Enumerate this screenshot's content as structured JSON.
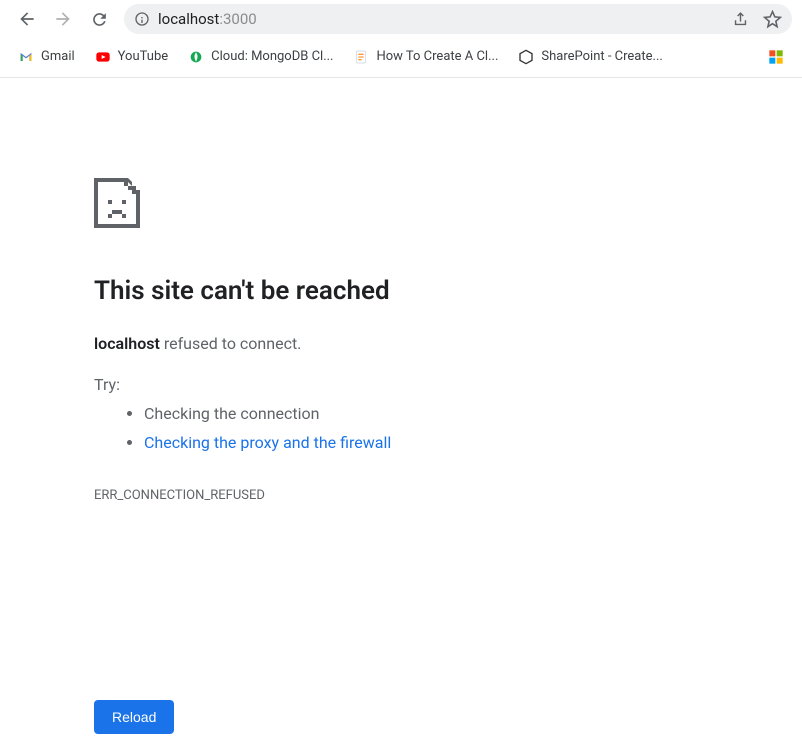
{
  "url": {
    "host": "localhost",
    "port": ":3000"
  },
  "bookmarks": [
    {
      "label": "Gmail",
      "icon": "gmail-icon"
    },
    {
      "label": "YouTube",
      "icon": "youtube-icon"
    },
    {
      "label": "Cloud: MongoDB Cl...",
      "icon": "mongodb-icon"
    },
    {
      "label": "How To Create A Cl...",
      "icon": "page-icon"
    },
    {
      "label": "SharePoint - Create...",
      "icon": "sharepoint-icon"
    }
  ],
  "error": {
    "heading": "This site can't be reached",
    "host_bold": "localhost",
    "msg_rest": " refused to connect.",
    "try_label": "Try:",
    "suggestions": {
      "plain": "Checking the connection",
      "link": "Checking the proxy and the firewall"
    },
    "code": "ERR_CONNECTION_REFUSED",
    "reload_label": "Reload"
  }
}
